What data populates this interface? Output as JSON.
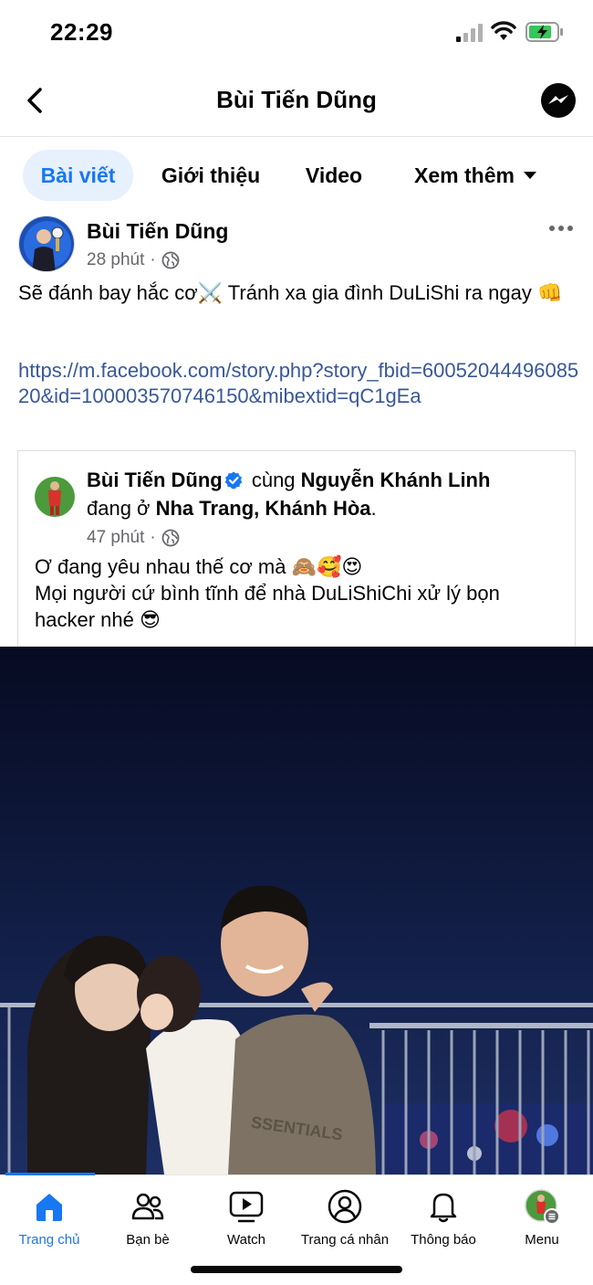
{
  "status_bar": {
    "time": "22:29"
  },
  "header": {
    "title": "Bùi Tiến Dũng",
    "back_icon": "chevron-left-icon",
    "messenger_icon": "messenger-icon"
  },
  "tabs": [
    {
      "label": "Bài viết",
      "active": true
    },
    {
      "label": "Giới thiệu",
      "active": false
    },
    {
      "label": "Video",
      "active": false
    },
    {
      "label": "Xem thêm",
      "active": false
    }
  ],
  "post": {
    "author": "Bùi Tiến Dũng",
    "time": "28 phút",
    "separator": "·",
    "text": "Sẽ đánh bay hắc cơ⚔️ Tránh xa gia đình DuLiShi ra ngay 👊",
    "link": "https://m.facebook.com/story.php?story_fbid=6005204449608520&id=100003570746150&mibextid=qC1gEa"
  },
  "shared": {
    "author": "Bùi Tiến Dũng",
    "with_word": "cùng",
    "with_name": "Nguyễn Khánh Linh",
    "at_word": "đang ở",
    "location": "Nha Trang, Khánh Hòa",
    "period": ".",
    "time": "47 phút",
    "separator": "·",
    "line1": "Ơ đang yêu nhau thế cơ mà 🙈🥰😍",
    "line2": "Mọi người cứ bình tĩnh để nhà DuLiShiChi xử lý bọn hacker nhé 😎"
  },
  "photo": {
    "shirt_text": "SSENTIALS"
  },
  "bottom_nav": [
    {
      "label": "Trang chủ",
      "icon": "home-icon",
      "active": true
    },
    {
      "label": "Bạn bè",
      "icon": "friends-icon",
      "active": false
    },
    {
      "label": "Watch",
      "icon": "watch-icon",
      "active": false
    },
    {
      "label": "Trang cá nhân",
      "icon": "profile-icon",
      "active": false
    },
    {
      "label": "Thông báo",
      "icon": "bell-icon",
      "active": false
    },
    {
      "label": "Menu",
      "icon": "menu-avatar-icon",
      "active": false
    }
  ],
  "colors": {
    "accent": "#1877f2",
    "link": "#385898",
    "secondary_text": "#65676b",
    "active_tab_bg": "#e7f0fd"
  }
}
